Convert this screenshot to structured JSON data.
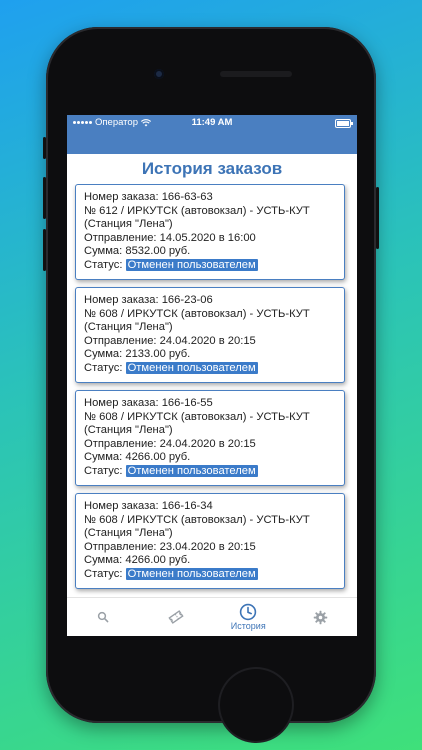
{
  "status_bar": {
    "carrier": "Оператор",
    "time": "11:49 AM"
  },
  "page_title": "История заказов",
  "orders": [
    {
      "number_line": "Номер заказа: 166-63-63",
      "route_line": "№ 612 / ИРКУТСК (автовокзал) - УСТЬ-КУТ",
      "station_line": "(Станция \"Лена\")",
      "departure_line": "Отправление: 14.05.2020 в 16:00",
      "sum_line": "Сумма: 8532.00 руб.",
      "status_label": "Статус:",
      "status_value": "Отменен пользователем"
    },
    {
      "number_line": "Номер заказа: 166-23-06",
      "route_line": "№ 608 / ИРКУТСК (автовокзал) - УСТЬ-КУТ",
      "station_line": "(Станция \"Лена\")",
      "departure_line": "Отправление: 24.04.2020 в 20:15",
      "sum_line": "Сумма: 2133.00 руб.",
      "status_label": "Статус:",
      "status_value": "Отменен пользователем"
    },
    {
      "number_line": "Номер заказа: 166-16-55",
      "route_line": "№ 608 / ИРКУТСК (автовокзал) - УСТЬ-КУТ",
      "station_line": "(Станция \"Лена\")",
      "departure_line": "Отправление: 24.04.2020 в 20:15",
      "sum_line": "Сумма: 4266.00 руб.",
      "status_label": "Статус:",
      "status_value": "Отменен пользователем"
    },
    {
      "number_line": "Номер заказа: 166-16-34",
      "route_line": "№ 608 / ИРКУТСК (автовокзал) - УСТЬ-КУТ",
      "station_line": "(Станция \"Лена\")",
      "departure_line": "Отправление: 23.04.2020 в 20:15",
      "sum_line": "Сумма: 4266.00 руб.",
      "status_label": "Статус:",
      "status_value": "Отменен пользователем"
    }
  ],
  "tab_bar": {
    "tabs": [
      {
        "icon": "search-icon",
        "label": ""
      },
      {
        "icon": "ticket-icon",
        "label": ""
      },
      {
        "icon": "clock-icon",
        "label": "История",
        "active": true
      },
      {
        "icon": "gear-icon",
        "label": ""
      }
    ]
  },
  "colors": {
    "accent": "#3d74b6",
    "status_badge": "#3b7bc9",
    "header": "#4a7fc1"
  }
}
